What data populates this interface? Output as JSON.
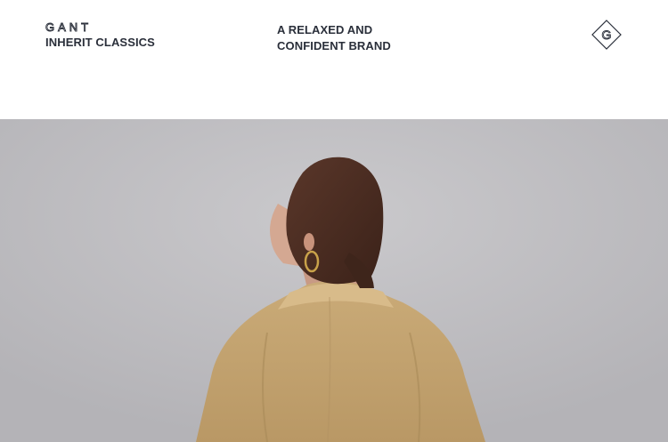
{
  "header": {
    "brand_wordmark": "GANT",
    "brand_tagline": "INHERIT CLASSICS",
    "slogan_line1": "A RELAXED AND",
    "slogan_line2": "CONFIDENT BRAND",
    "monogram_letter": "G",
    "monogram_icon": "gant-g-diamond-icon"
  },
  "hero": {
    "image_subject": "woman-in-khaki-shirt-back-view",
    "background_color": "#c1c0c4",
    "shirt_color": "#c4a573",
    "hair_color": "#4a2c22"
  },
  "colors": {
    "text": "#2a2f3a",
    "background": "#ffffff"
  }
}
